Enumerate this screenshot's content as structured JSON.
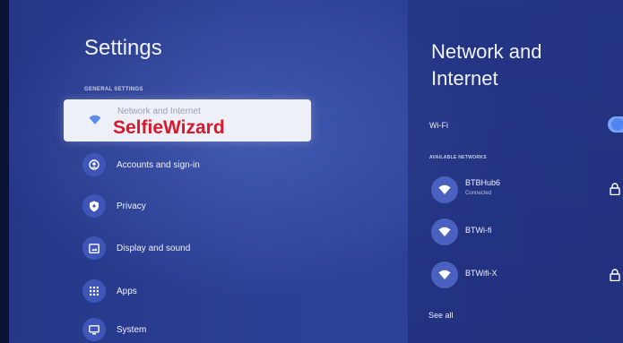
{
  "settings_panel": {
    "title": "Settings",
    "section_label": "GENERAL SETTINGS",
    "selected_item": {
      "label": "Network and Internet",
      "icon": "wifi-icon"
    },
    "items": [
      {
        "label": "Accounts and sign-in",
        "icon": "account-icon"
      },
      {
        "label": "Privacy",
        "icon": "shield-icon"
      },
      {
        "label": "Display and sound",
        "icon": "display-icon"
      },
      {
        "label": "Apps",
        "icon": "apps-grid-icon"
      },
      {
        "label": "System",
        "icon": "monitor-icon"
      }
    ]
  },
  "watermark": "SelfieWizard",
  "network_panel": {
    "title": "Network and Internet",
    "wifi_label": "Wi-Fi",
    "wifi_enabled": true,
    "available_label": "AVAILABLE NETWORKS",
    "networks": [
      {
        "name": "BTBHub6",
        "status": "Connected",
        "locked": true
      },
      {
        "name": "BTWi-fi",
        "status": "",
        "locked": false
      },
      {
        "name": "BTWifi-X",
        "status": "",
        "locked": true
      }
    ],
    "see_all": "See all"
  },
  "colors": {
    "accent": "#4f85f0",
    "icon_circle": "#3f56b8",
    "background": "#2b3f95",
    "watermark": "#d8182b"
  }
}
